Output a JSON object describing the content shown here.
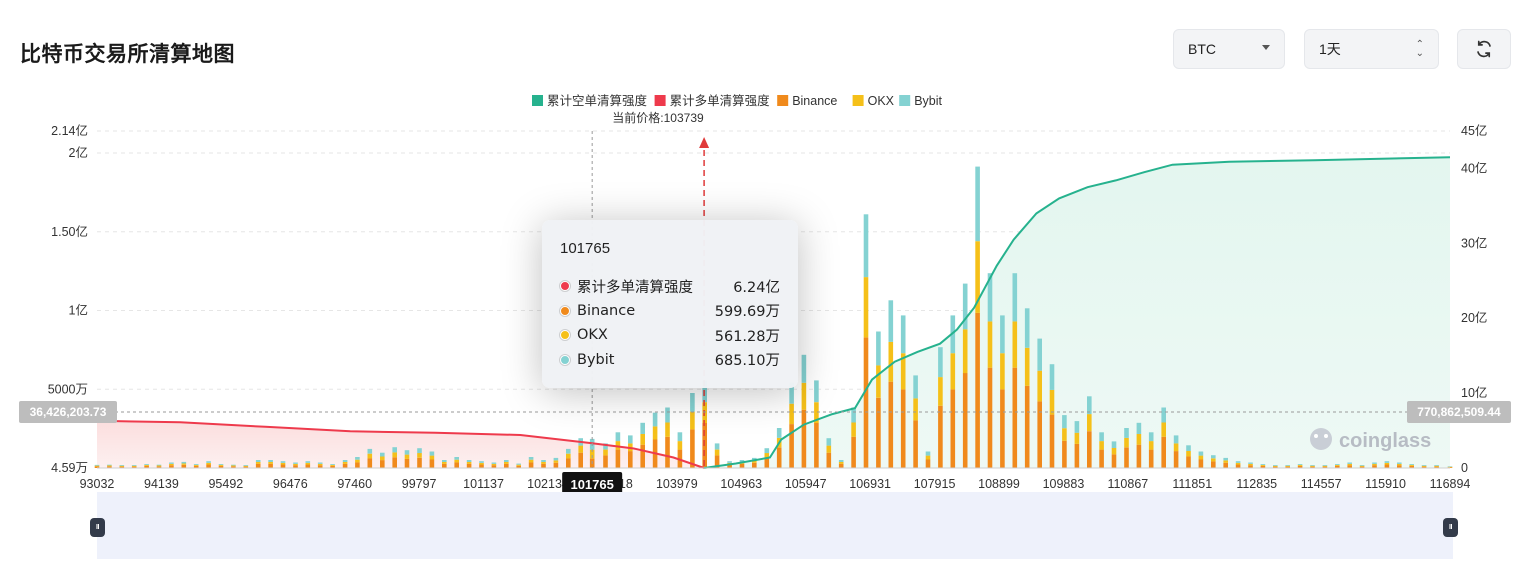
{
  "page": {
    "title": "比特币交易所清算地图"
  },
  "controls": {
    "symbol": "BTC",
    "timeframe": "1天"
  },
  "legend": [
    {
      "label": "累计空单清算强度",
      "color": "#26b28e"
    },
    {
      "label": "累计多单清算强度",
      "color": "#ee3a4c"
    },
    {
      "label": "Binance",
      "color": "#f08a1c"
    },
    {
      "label": "OKX",
      "color": "#f5c019"
    },
    {
      "label": "Bybit",
      "color": "#84d2d2"
    }
  ],
  "current_price_label": "当前价格:103739",
  "left_marker": "36,426,203.73",
  "right_marker": "770,862,509.44",
  "hover_x_label": "101765",
  "watermark": "coinglass",
  "tooltip": {
    "title": "101765",
    "rows": [
      {
        "label": "累计多单清算强度",
        "value": "6.24亿",
        "color": "#ee3a4c"
      },
      {
        "label": "Binance",
        "value": "599.69万",
        "color": "#f08a1c"
      },
      {
        "label": "OKX",
        "value": "561.28万",
        "color": "#f5c019"
      },
      {
        "label": "Bybit",
        "value": "685.10万",
        "color": "#84d2d2"
      }
    ]
  },
  "chart_data": {
    "type": "bar",
    "xlim": [
      93032,
      116894
    ],
    "current_price": 103739,
    "x_tick_labels": [
      "93032",
      "94139",
      "95492",
      "96476",
      "97460",
      "99797",
      "101137",
      "102134",
      "103118",
      "103979",
      "104963",
      "105947",
      "106931",
      "107915",
      "108899",
      "109883",
      "110867",
      "111851",
      "112835",
      "114557",
      "115910",
      "116894"
    ],
    "left_axis": {
      "ticks": [
        "2.14亿",
        "2亿",
        "1.50亿",
        "1亿",
        "5000万",
        "4.59万"
      ],
      "values": [
        214000000,
        200000000,
        150000000,
        100000000,
        50000000,
        45900
      ],
      "ylim": [
        45900,
        214000000
      ]
    },
    "right_axis": {
      "ticks": [
        "45亿",
        "40亿",
        "30亿",
        "20亿",
        "10亿",
        "0"
      ],
      "values": [
        4500000000,
        4000000000,
        3000000000,
        2000000000,
        1000000000,
        0
      ],
      "ylim": [
        0,
        4500000000
      ]
    },
    "bars_binance_okx_bybit": [
      [
        93032,
        1000000,
        500000,
        500000
      ],
      [
        93250,
        1100000,
        500000,
        500000
      ],
      [
        93469,
        900000,
        500000,
        500000
      ],
      [
        93688,
        900000,
        500000,
        500000
      ],
      [
        93907,
        1300000,
        600000,
        600000
      ],
      [
        94125,
        1100000,
        500000,
        500000
      ],
      [
        94344,
        1800000,
        800000,
        900000
      ],
      [
        94563,
        2000000,
        900000,
        1000000
      ],
      [
        94782,
        1300000,
        600000,
        600000
      ],
      [
        95000,
        2200000,
        1000000,
        1100000
      ],
      [
        95219,
        1300000,
        600000,
        600000
      ],
      [
        95438,
        1100000,
        500000,
        500000
      ],
      [
        95657,
        900000,
        500000,
        500000
      ],
      [
        95875,
        2600000,
        1200000,
        1300000
      ],
      [
        96094,
        2600000,
        1200000,
        1300000
      ],
      [
        96313,
        2200000,
        1000000,
        1100000
      ],
      [
        96532,
        1800000,
        800000,
        900000
      ],
      [
        96750,
        2200000,
        1000000,
        1100000
      ],
      [
        96969,
        1800000,
        800000,
        900000
      ],
      [
        97188,
        1300000,
        600000,
        600000
      ],
      [
        97407,
        2600000,
        1200000,
        1300000
      ],
      [
        97625,
        3600000,
        1700000,
        1700000
      ],
      [
        97844,
        6200000,
        2900000,
        3000000
      ],
      [
        98063,
        5000000,
        2300000,
        2400000
      ],
      [
        98282,
        6800000,
        3100000,
        3300000
      ],
      [
        98500,
        5800000,
        2700000,
        2800000
      ],
      [
        98719,
        6500000,
        3000000,
        3100000
      ],
      [
        98938,
        5400000,
        2500000,
        2600000
      ],
      [
        99157,
        2600000,
        1200000,
        1300000
      ],
      [
        99375,
        3600000,
        1700000,
        1700000
      ],
      [
        99594,
        2600000,
        1200000,
        1300000
      ],
      [
        99813,
        2200000,
        1000000,
        1100000
      ],
      [
        100032,
        1800000,
        800000,
        900000
      ],
      [
        100250,
        2600000,
        1200000,
        1300000
      ],
      [
        100469,
        1400000,
        700000,
        700000
      ],
      [
        100688,
        3600000,
        1700000,
        1700000
      ],
      [
        100907,
        2600000,
        1200000,
        1300000
      ],
      [
        101125,
        3300000,
        1500000,
        1600000
      ],
      [
        101344,
        6200000,
        2900000,
        3000000
      ],
      [
        101563,
        9700000,
        4500000,
        4700000
      ],
      [
        101765,
        5996900,
        5612800,
        6851000
      ],
      [
        102000,
        8000000,
        3700000,
        3900000
      ],
      [
        102219,
        11700000,
        5400000,
        5600000
      ],
      [
        102438,
        10700000,
        4900000,
        5100000
      ],
      [
        102657,
        14800000,
        6800000,
        7100000
      ],
      [
        102875,
        18100000,
        8300000,
        8700000
      ],
      [
        103094,
        19800000,
        9100000,
        9500000
      ],
      [
        103313,
        11700000,
        5400000,
        5600000
      ],
      [
        103532,
        24500000,
        11300000,
        11800000
      ],
      [
        103750,
        28600000,
        13200000,
        13800000
      ],
      [
        103969,
        8000000,
        3700000,
        3900000
      ],
      [
        104188,
        2200000,
        1000000,
        1100000
      ],
      [
        104407,
        2600000,
        1200000,
        1300000
      ],
      [
        104625,
        3300000,
        1500000,
        1600000
      ],
      [
        104844,
        6500000,
        3000000,
        3100000
      ],
      [
        105063,
        13100000,
        6000000,
        6300000
      ],
      [
        105282,
        27900000,
        12900000,
        13400000
      ],
      [
        105500,
        37000000,
        17100000,
        17800000
      ],
      [
        105719,
        28600000,
        13200000,
        13800000
      ],
      [
        105938,
        9700000,
        4500000,
        4700000
      ],
      [
        106157,
        2600000,
        1200000,
        1300000
      ],
      [
        106375,
        19800000,
        9100000,
        9500000
      ],
      [
        106594,
        82900000,
        38300000,
        39900000
      ],
      [
        106813,
        44600000,
        20600000,
        21500000
      ],
      [
        107032,
        54800000,
        25300000,
        26400000
      ],
      [
        107250,
        49900000,
        23000000,
        24000000
      ],
      [
        107469,
        30200000,
        14000000,
        14600000
      ],
      [
        107688,
        5400000,
        2500000,
        2600000
      ],
      [
        107907,
        39500000,
        18200000,
        19000000
      ],
      [
        108125,
        49900000,
        23000000,
        24000000
      ],
      [
        108344,
        60300000,
        27800000,
        29000000
      ],
      [
        108563,
        98500000,
        45500000,
        47400000
      ],
      [
        108782,
        63700000,
        29400000,
        30600000
      ],
      [
        109000,
        49900000,
        23000000,
        24000000
      ],
      [
        109219,
        63700000,
        29400000,
        30600000
      ],
      [
        109438,
        52200000,
        24100000,
        25100000
      ],
      [
        109657,
        42300000,
        19500000,
        20400000
      ],
      [
        109875,
        33900000,
        15700000,
        16300000
      ],
      [
        110094,
        17300000,
        8000000,
        8300000
      ],
      [
        110313,
        15300000,
        7100000,
        7400000
      ],
      [
        110532,
        23400000,
        10800000,
        11300000
      ],
      [
        110750,
        11700000,
        5400000,
        5600000
      ],
      [
        110969,
        8700000,
        4000000,
        4200000
      ],
      [
        111188,
        13100000,
        6000000,
        6300000
      ],
      [
        111407,
        14800000,
        6800000,
        7100000
      ],
      [
        111625,
        11700000,
        5400000,
        5600000
      ],
      [
        111844,
        19800000,
        9100000,
        9500000
      ],
      [
        112063,
        10700000,
        4900000,
        5100000
      ],
      [
        112282,
        7400000,
        3400000,
        3600000
      ],
      [
        112500,
        5400000,
        2500000,
        2600000
      ],
      [
        112719,
        4200000,
        1900000,
        2000000
      ],
      [
        112938,
        3300000,
        1500000,
        1600000
      ],
      [
        113157,
        2200000,
        1000000,
        1100000
      ],
      [
        113375,
        1800000,
        800000,
        900000
      ],
      [
        113594,
        1300000,
        600000,
        600000
      ],
      [
        113813,
        900000,
        500000,
        500000
      ],
      [
        114032,
        900000,
        500000,
        500000
      ],
      [
        114250,
        1300000,
        600000,
        600000
      ],
      [
        114469,
        900000,
        500000,
        500000
      ],
      [
        114688,
        900000,
        500000,
        500000
      ],
      [
        114907,
        1300000,
        600000,
        600000
      ],
      [
        115125,
        1800000,
        800000,
        900000
      ],
      [
        115344,
        900000,
        500000,
        500000
      ],
      [
        115563,
        1800000,
        800000,
        900000
      ],
      [
        115782,
        2200000,
        1000000,
        1100000
      ],
      [
        116000,
        1800000,
        800000,
        900000
      ],
      [
        116219,
        1300000,
        600000,
        600000
      ],
      [
        116438,
        900000,
        500000,
        500000
      ],
      [
        116657,
        900000,
        500000,
        500000
      ],
      [
        116894,
        500000,
        300000,
        300000
      ]
    ],
    "cumulative_long": [
      [
        93032,
        630000000
      ],
      [
        94500,
        610000000
      ],
      [
        96000,
        550000000
      ],
      [
        97500,
        490000000
      ],
      [
        99000,
        470000000
      ],
      [
        100500,
        440000000
      ],
      [
        101765,
        330000000
      ],
      [
        102500,
        260000000
      ],
      [
        103200,
        140000000
      ],
      [
        103739,
        0
      ]
    ],
    "cumulative_short": [
      [
        103739,
        0
      ],
      [
        104300,
        60000000
      ],
      [
        104900,
        140000000
      ],
      [
        105100,
        380000000
      ],
      [
        105500,
        580000000
      ],
      [
        106000,
        720000000
      ],
      [
        106400,
        800000000
      ],
      [
        106700,
        1180000000
      ],
      [
        107100,
        1420000000
      ],
      [
        107500,
        1550000000
      ],
      [
        107900,
        1660000000
      ],
      [
        108200,
        1850000000
      ],
      [
        108500,
        2140000000
      ],
      [
        108900,
        2700000000
      ],
      [
        109200,
        3050000000
      ],
      [
        109600,
        3400000000
      ],
      [
        110000,
        3600000000
      ],
      [
        110500,
        3750000000
      ],
      [
        111000,
        3840000000
      ],
      [
        111500,
        3950000000
      ],
      [
        112000,
        4050000000
      ],
      [
        113000,
        4090000000
      ],
      [
        114500,
        4110000000
      ],
      [
        116894,
        4150000000
      ]
    ]
  }
}
